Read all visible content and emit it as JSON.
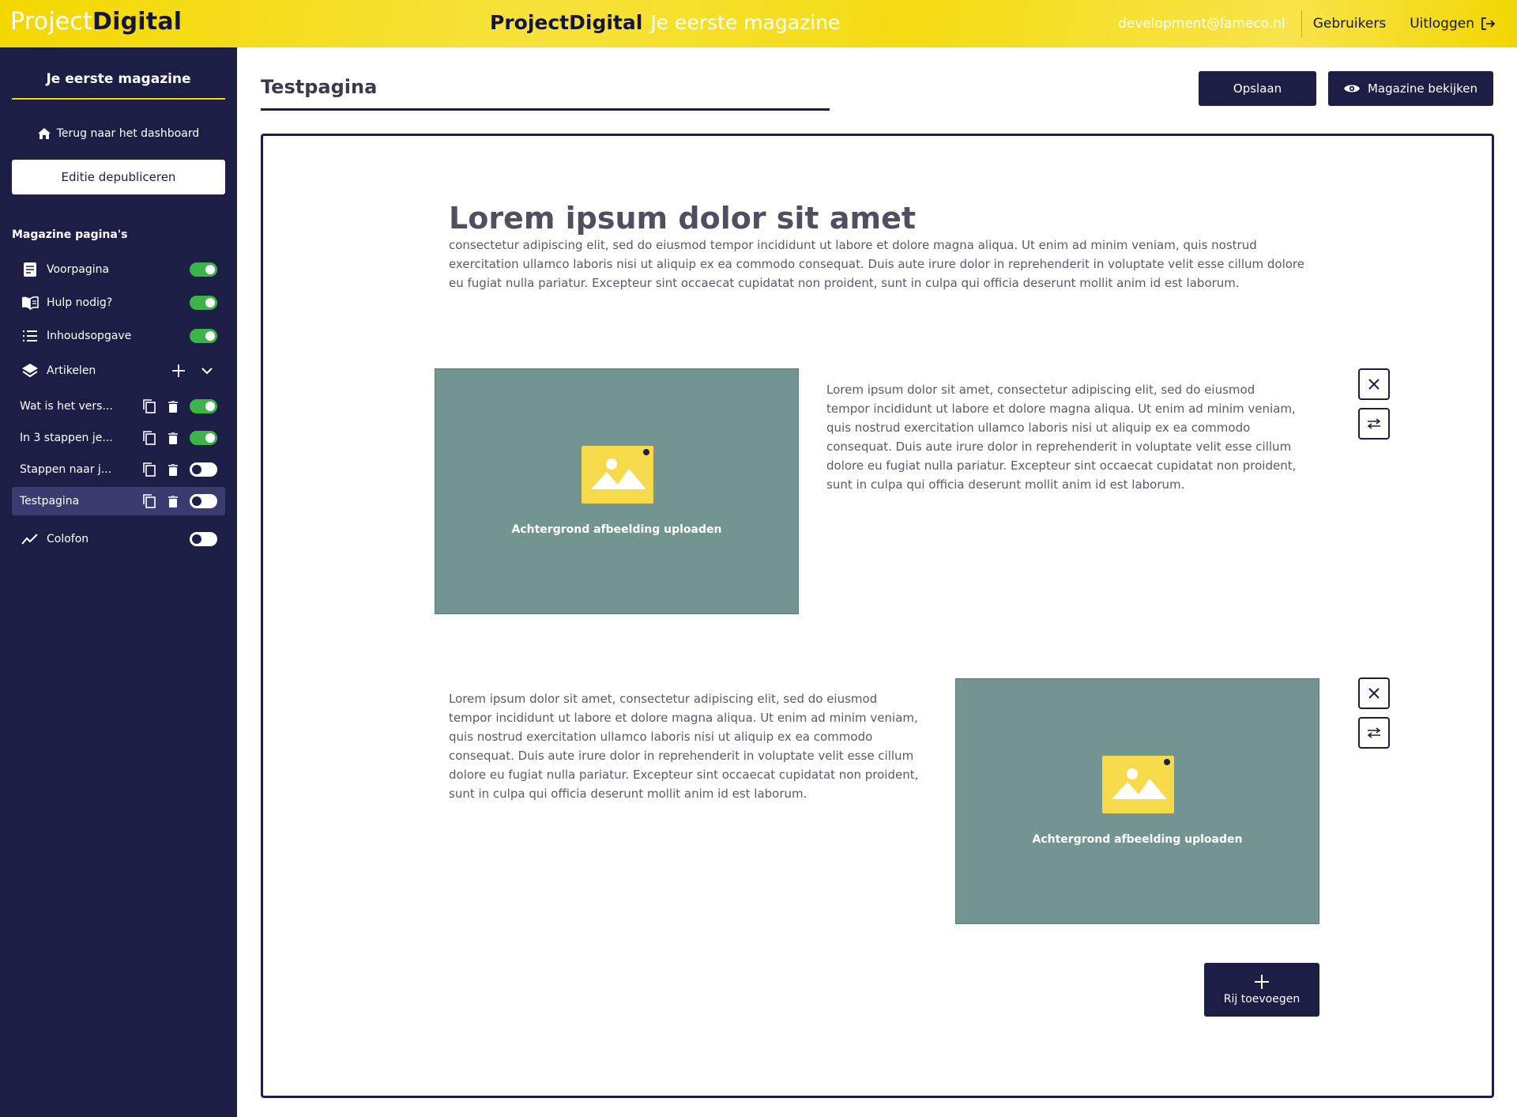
{
  "app": {
    "brand_light": "Project",
    "brand_bold": "Digital",
    "title_bold": "ProjectDigital",
    "title_light": "Je eerste magazine"
  },
  "topnav": {
    "email": "development@lameco.nl",
    "users": "Gebruikers",
    "logout": "Uitloggen"
  },
  "sidebar": {
    "title": "Je eerste magazine",
    "back_label": "Terug naar het dashboard",
    "unpublish_label": "Editie depubliceren",
    "section_label": "Magazine pagina's",
    "items": [
      {
        "label": "Voorpagina",
        "icon": "document-icon",
        "enabled": true
      },
      {
        "label": "Hulp nodig?",
        "icon": "book-icon",
        "enabled": true
      },
      {
        "label": "Inhoudsopgave",
        "icon": "list-icon",
        "enabled": true
      },
      {
        "label": "Artikelen",
        "icon": "layers-icon"
      },
      {
        "label": "Wat is het vers...",
        "enabled": true
      },
      {
        "label": "In 3 stappen je...",
        "enabled": true
      },
      {
        "label": "Stappen naar j...",
        "enabled": false
      },
      {
        "label": "Testpagina",
        "enabled": false,
        "active": true
      },
      {
        "label": "Colofon",
        "icon": "chart-line-icon",
        "enabled": false
      }
    ]
  },
  "page": {
    "title": "Testpagina",
    "save_label": "Opslaan",
    "view_label": "Magazine bekijken"
  },
  "content": {
    "heading": "Lorem ipsum dolor sit amet",
    "intro": "consectetur adipiscing elit, sed do eiusmod tempor incididunt ut labore et dolore magna aliqua. Ut enim ad minim veniam, quis nostrud exercitation ullamco laboris nisi ut aliquip ex ea commodo consequat. Duis aute irure dolor in reprehenderit in voluptate velit esse cillum dolore eu fugiat nulla pariatur. Excepteur sint occaecat cupidatat non proident, sunt in culpa qui officia deserunt mollit anim id est laborum.",
    "rows": [
      {
        "text": "Lorem ipsum dolor sit amet, consectetur adipiscing elit, sed do eiusmod tempor incididunt ut labore et dolore magna aliqua. Ut enim ad minim veniam, quis nostrud exercitation ullamco laboris nisi ut aliquip ex ea commodo consequat. Duis aute irure dolor in reprehenderit in voluptate velit esse cillum dolore eu fugiat nulla pariatur. Excepteur sint occaecat cupidatat non proident, sunt in culpa qui officia deserunt mollit anim id est laborum.",
        "upload_label": "Achtergrond afbeelding uploaden"
      },
      {
        "text": "Lorem ipsum dolor sit amet, consectetur adipiscing elit, sed do eiusmod tempor incididunt ut labore et dolore magna aliqua. Ut enim ad minim veniam, quis nostrud exercitation ullamco laboris nisi ut aliquip ex ea commodo consequat. Duis aute irure dolor in reprehenderit in voluptate velit esse cillum dolore eu fugiat nulla pariatur. Excepteur sint occaecat cupidatat non proident, sunt in culpa qui officia deserunt mollit anim id est laborum.",
        "upload_label": "Achtergrond afbeelding uploaden"
      }
    ],
    "add_row_label": "Rij toevoegen"
  },
  "colors": {
    "brand_yellow": "#f3d800",
    "navy": "#1d1e45",
    "toggle_on": "#3cb44a",
    "image_placeholder": "#729591"
  }
}
